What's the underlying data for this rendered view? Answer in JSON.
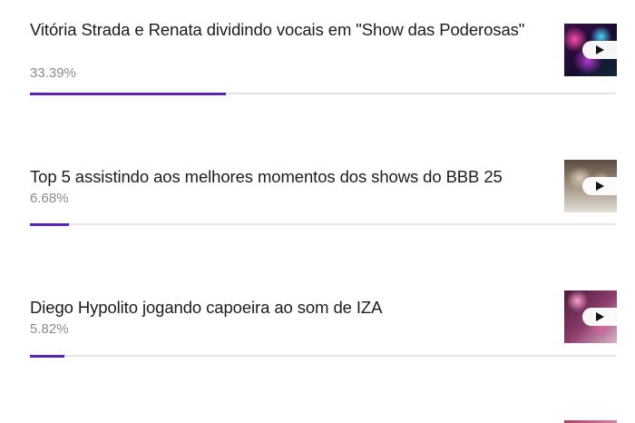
{
  "poll": {
    "accent_color": "#5a24b8",
    "track_color": "#e4e4e4",
    "options": [
      {
        "title": "Vitória Strada e Renata dividindo vocais em \"Show das Poderosas\"",
        "percent_label": "33.39%",
        "percent": 33.39,
        "media_icon": "play-icon"
      },
      {
        "title": "Top 5 assistindo aos melhores momentos dos shows do BBB 25",
        "percent_label": "6.68%",
        "percent": 6.68,
        "media_icon": "play-icon"
      },
      {
        "title": "Diego Hypolito jogando capoeira ao som de IZA",
        "percent_label": "5.82%",
        "percent": 5.82,
        "media_icon": "play-icon"
      }
    ]
  }
}
